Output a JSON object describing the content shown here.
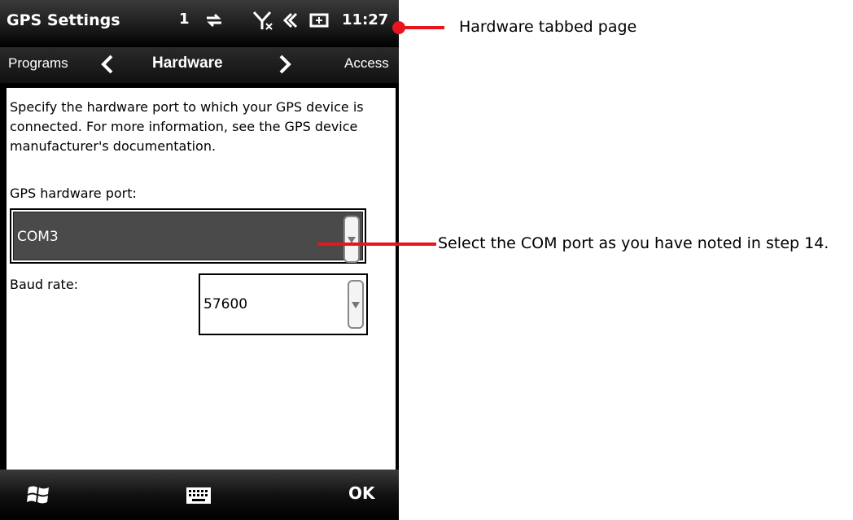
{
  "status_bar": {
    "app_title": "GPS Settings",
    "signal_count": "1",
    "time": "11:27",
    "icons": [
      "data-transfer-icon",
      "no-signal-icon",
      "speaker-muted-icon",
      "battery-charging-icon"
    ]
  },
  "tabs": {
    "previous": "Programs",
    "current": "Hardware",
    "next": "Access"
  },
  "content": {
    "description": "Specify the hardware port to which your GPS device is connected. For more information, see the GPS device manufacturer's documentation.",
    "port_label": "GPS hardware port:",
    "port_value": "COM3",
    "baud_label": "Baud rate:",
    "baud_value": "57600"
  },
  "menu_bar": {
    "ok_label": "OK",
    "icons": [
      "windows-start-icon",
      "keyboard-icon"
    ]
  },
  "annotations": {
    "tabbed_page": "Hardware tabbed page",
    "com_port_note": "Select the COM port as you have noted in step 14."
  },
  "colors": {
    "annotation_red": "#e8141e",
    "selected_field": "#4a4a4a"
  }
}
